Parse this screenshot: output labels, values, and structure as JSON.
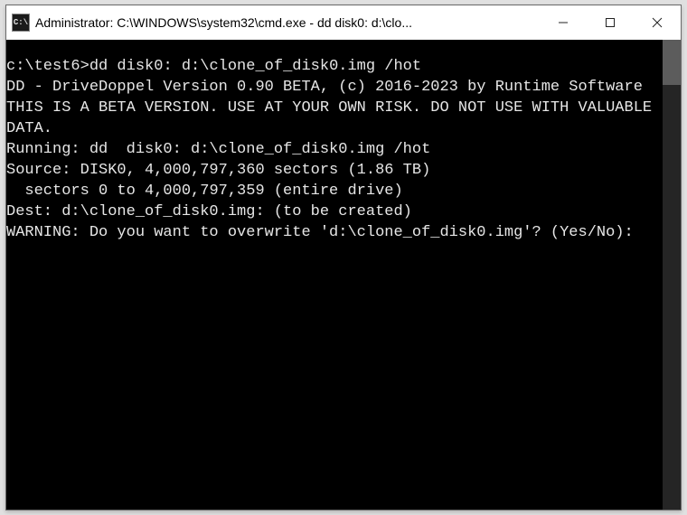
{
  "window": {
    "title": "Administrator: C:\\WINDOWS\\system32\\cmd.exe - dd  disk0: d:\\clo...",
    "icon_label": "C:\\"
  },
  "terminal": {
    "prompt": "c:\\test6>",
    "command": "dd disk0: d:\\clone_of_disk0.img /hot",
    "lines": [
      "DD - DriveDoppel Version 0.90 BETA, (c) 2016-2023 by Runtime Software",
      "THIS IS A BETA VERSION. USE AT YOUR OWN RISK. DO NOT USE WITH VALUABLE DATA.",
      "Running: dd  disk0: d:\\clone_of_disk0.img /hot",
      "Source: DISK0, 4,000,797,360 sectors (1.86 TB)",
      "  sectors 0 to 4,000,797,359 (entire drive)",
      "Dest: d:\\clone_of_disk0.img: (to be created)",
      "WARNING: Do you want to overwrite 'd:\\clone_of_disk0.img'? (Yes/No):"
    ]
  }
}
